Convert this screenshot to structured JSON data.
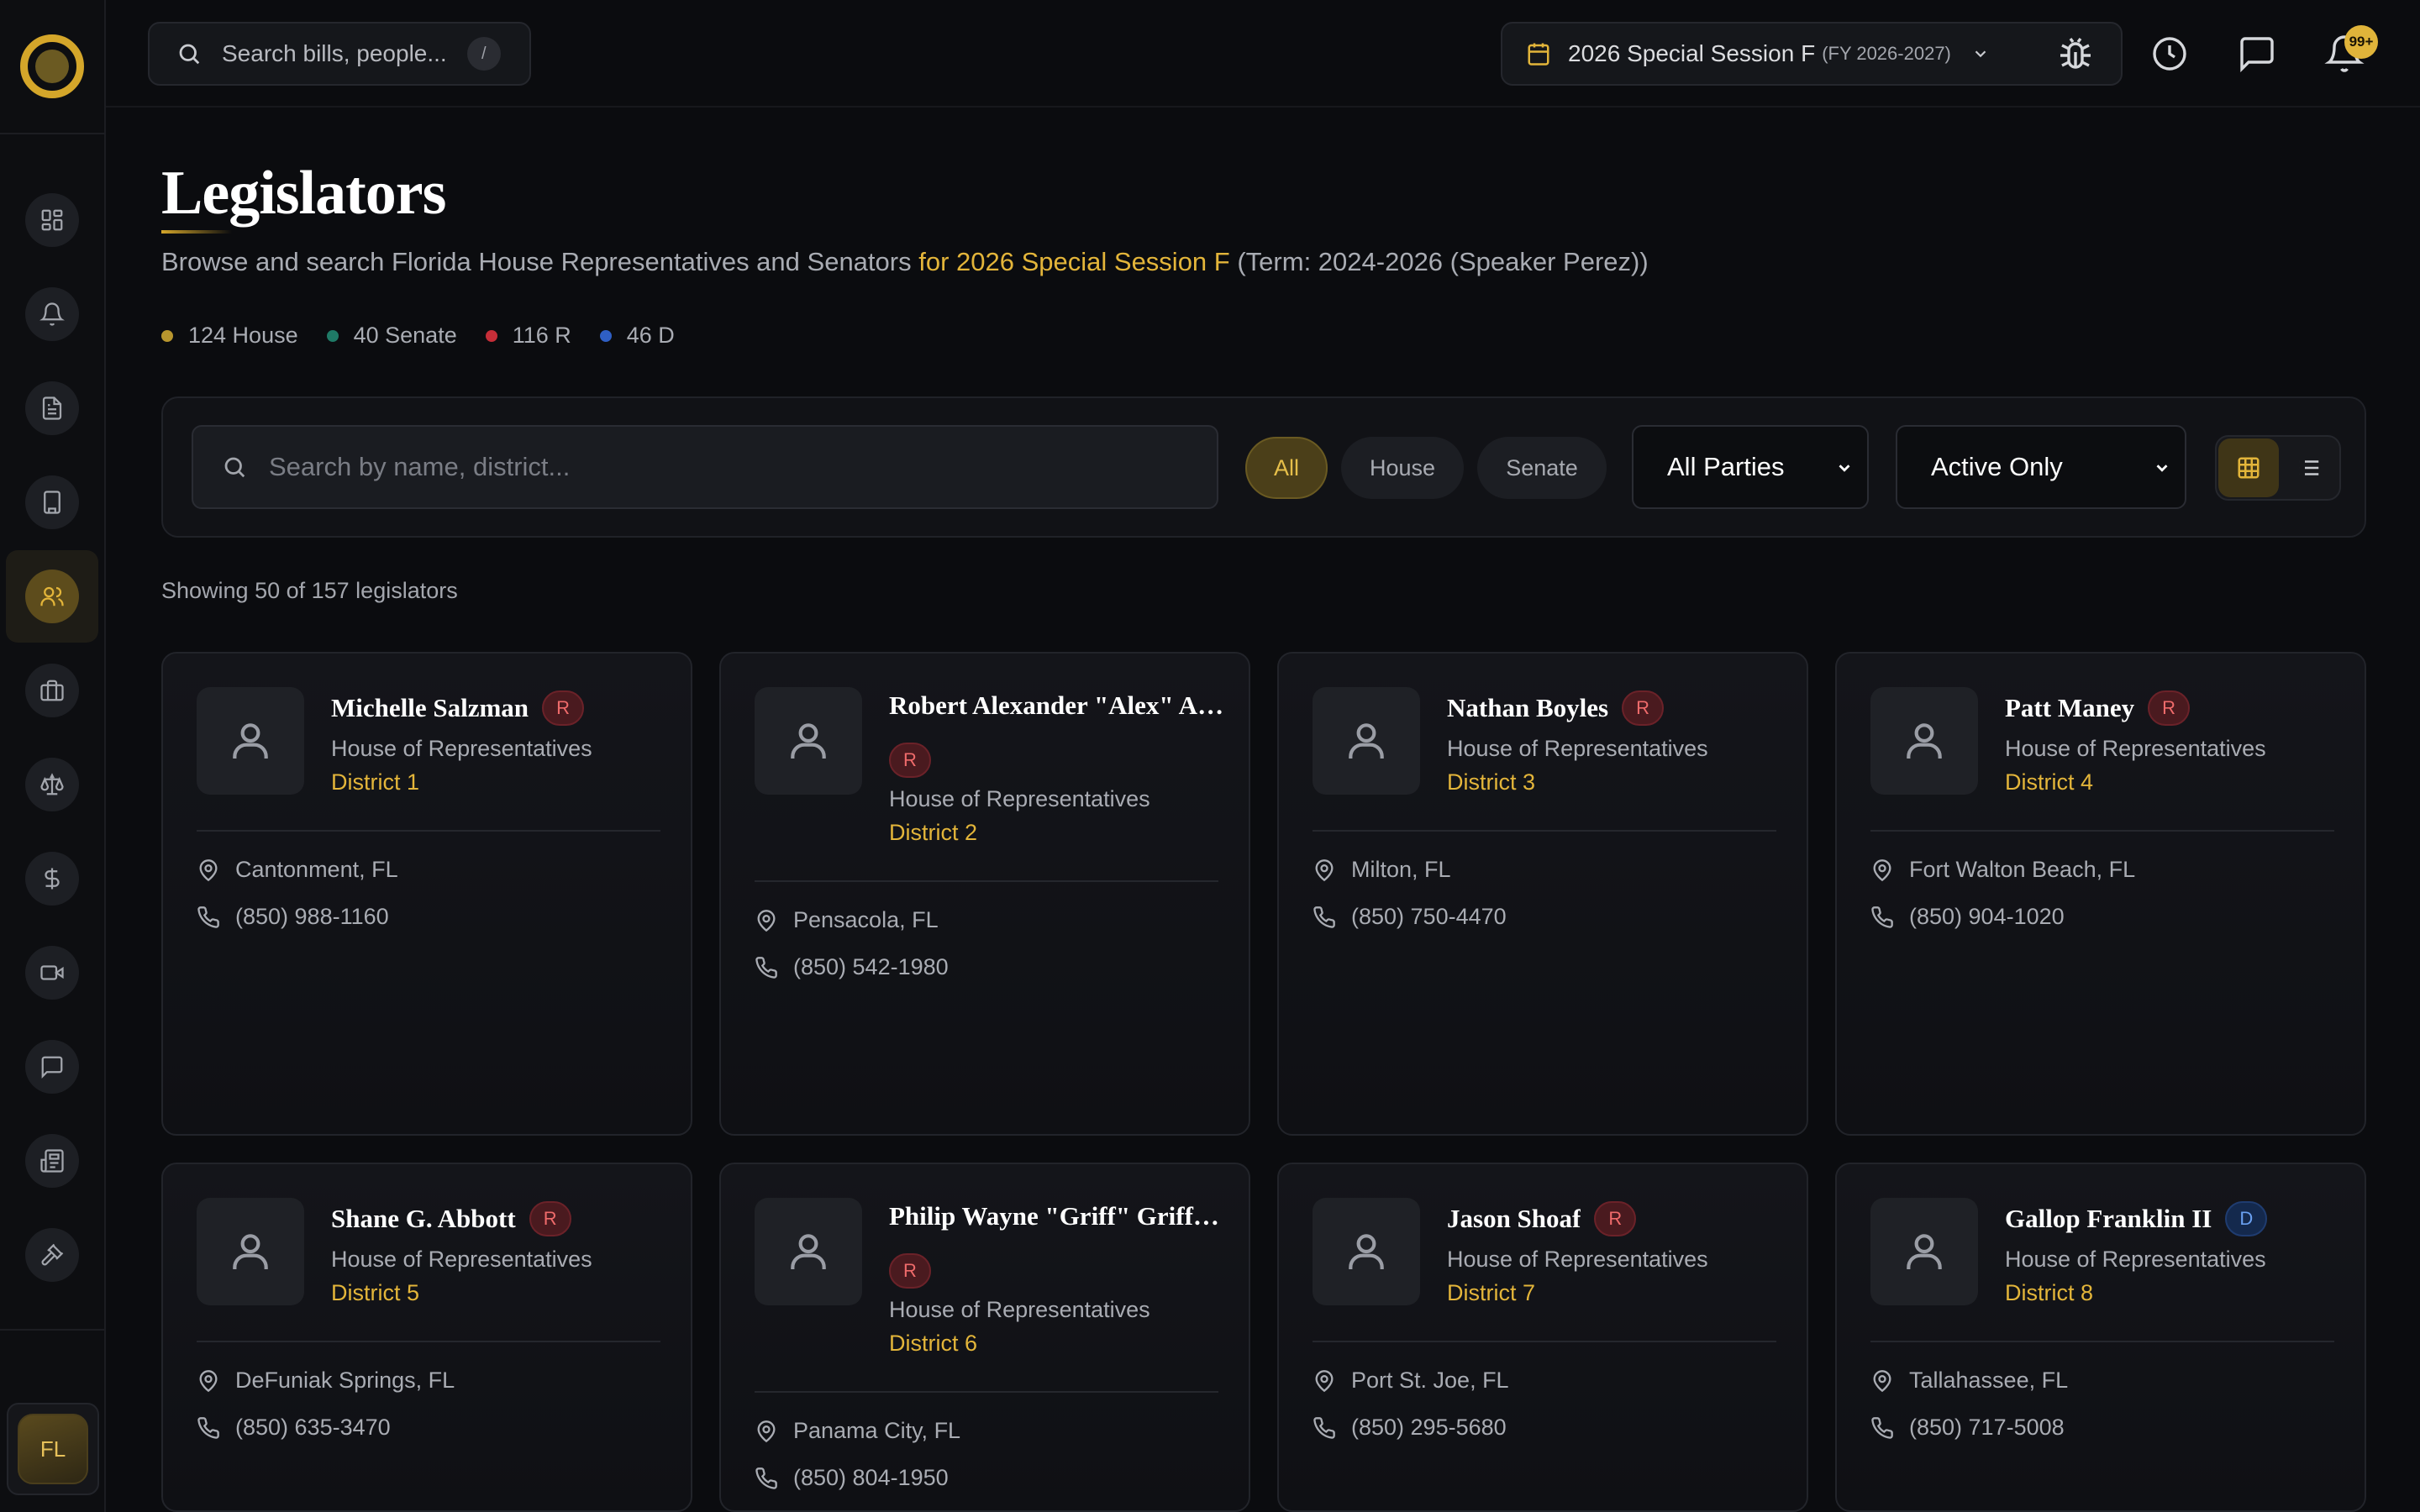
{
  "app": {
    "user_initials": "FL"
  },
  "topbar": {
    "search_placeholder": "Search bills, people...",
    "search_shortcut": "/",
    "session_label": "2026 Special Session F",
    "session_sub": "(FY 2026-2027)",
    "notification_count": "99+"
  },
  "sidebar": {
    "items": [
      {
        "name": "dashboard",
        "icon": "dashboard-icon"
      },
      {
        "name": "alerts",
        "icon": "bell-icon"
      },
      {
        "name": "bills",
        "icon": "document-icon"
      },
      {
        "name": "capitol",
        "icon": "building-icon"
      },
      {
        "name": "legislators",
        "icon": "users-icon",
        "active": true
      },
      {
        "name": "lobbying",
        "icon": "briefcase-icon"
      },
      {
        "name": "legal",
        "icon": "scale-icon"
      },
      {
        "name": "finance",
        "icon": "dollar-icon"
      },
      {
        "name": "video",
        "icon": "video-icon"
      },
      {
        "name": "messages",
        "icon": "chat-icon"
      },
      {
        "name": "news",
        "icon": "newspaper-icon"
      },
      {
        "name": "votes",
        "icon": "gavel-icon"
      }
    ]
  },
  "page": {
    "title": "Legislators",
    "subtitle_main": "Browse and search Florida House Representatives and Senators",
    "subtitle_session": "for 2026 Special Session F",
    "subtitle_term": "(Term: 2024-2026 (Speaker Perez))",
    "stats": [
      {
        "label": "124 House",
        "color": "#b8962e"
      },
      {
        "label": "40 Senate",
        "color": "#1f7a66"
      },
      {
        "label": "116 R",
        "color": "#c62e38"
      },
      {
        "label": "46 D",
        "color": "#2f5fc4"
      }
    ],
    "showing": "Showing 50 of 157 legislators"
  },
  "filters": {
    "search_placeholder": "Search by name, district...",
    "chamber_all": "All",
    "chamber_house": "House",
    "chamber_senate": "Senate",
    "party_value": "All Parties",
    "status_value": "Active Only",
    "view_mode": "grid"
  },
  "colors": {
    "accent": "#e3b53a",
    "republican": "#ef6b6b",
    "democrat": "#6aa0f0"
  },
  "legislators": [
    {
      "name": "Michelle Salzman",
      "party": "R",
      "chamber": "House of Representatives",
      "district": "District 1",
      "location": "Cantonment, FL",
      "phone": "(850) 988-1160"
    },
    {
      "name": "Robert Alexander \"Alex\" Andrade",
      "party": "R",
      "chamber": "House of Representatives",
      "district": "District 2",
      "location": "Pensacola, FL",
      "phone": "(850) 542-1980"
    },
    {
      "name": "Nathan Boyles",
      "party": "R",
      "chamber": "House of Representatives",
      "district": "District 3",
      "location": "Milton, FL",
      "phone": "(850) 750-4470"
    },
    {
      "name": "Patt Maney",
      "party": "R",
      "chamber": "House of Representatives",
      "district": "District 4",
      "location": "Fort Walton Beach, FL",
      "phone": "(850) 904-1020"
    },
    {
      "name": "Shane G. Abbott",
      "party": "R",
      "chamber": "House of Representatives",
      "district": "District 5",
      "location": "DeFuniak Springs, FL",
      "phone": "(850) 635-3470"
    },
    {
      "name": "Philip Wayne \"Griff\" Griffitts",
      "party": "R",
      "chamber": "House of Representatives",
      "district": "District 6",
      "location": "Panama City, FL",
      "phone": "(850) 804-1950"
    },
    {
      "name": "Jason Shoaf",
      "party": "R",
      "chamber": "House of Representatives",
      "district": "District 7",
      "location": "Port St. Joe, FL",
      "phone": "(850) 295-5680"
    },
    {
      "name": "Gallop Franklin II",
      "party": "D",
      "chamber": "House of Representatives",
      "district": "District 8",
      "location": "Tallahassee, FL",
      "phone": "(850) 717-5008"
    }
  ]
}
